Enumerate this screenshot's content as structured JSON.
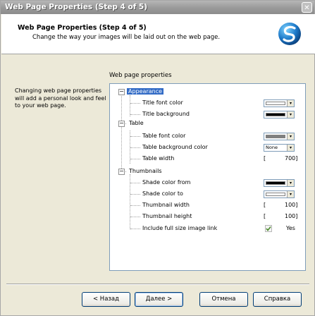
{
  "window": {
    "title": "Web Page Properties (Step 4 of 5)",
    "close_glyph": "✕"
  },
  "header": {
    "title": "Web Page Properties (Step 4 of 5)",
    "subtitle": "Change the way your images will be laid out on the web page."
  },
  "left_text": "Changing web page properties will add a personal look and feel to your web page.",
  "group_label": "Web page properties",
  "tree": {
    "appearance": {
      "label": "Appearance",
      "expander": "−",
      "title_font_color": {
        "label": "Title font color",
        "color": "#FFFFFF"
      },
      "title_background": {
        "label": "Title background",
        "color": "#000000"
      }
    },
    "table": {
      "label": "Table",
      "expander": "−",
      "font_color": {
        "label": "Table font color",
        "color": "#808080"
      },
      "background_color": {
        "label": "Table background color",
        "value": "None"
      },
      "width": {
        "label": "Table width",
        "bracket": "[",
        "value": "700]"
      }
    },
    "thumbnails": {
      "label": "Thumbnails",
      "expander": "−",
      "shade_from": {
        "label": "Shade color from",
        "color": "#000000"
      },
      "shade_to": {
        "label": "Shade color to",
        "color": "#FFFFFF"
      },
      "width": {
        "label": "Thumbnail width",
        "bracket": "[",
        "value": "100]"
      },
      "height": {
        "label": "Thumbnail height",
        "bracket": "[",
        "value": "100]"
      },
      "include_link": {
        "label": "Include full size image link",
        "value": "Yes"
      }
    }
  },
  "buttons": {
    "back": "< Назад",
    "next": "Далее >",
    "cancel": "Отмена",
    "help": "Справка"
  },
  "colors": {
    "title_bar": "#A0A0A0",
    "selection": "#316AC5",
    "panel_border": "#7F9DB9"
  }
}
